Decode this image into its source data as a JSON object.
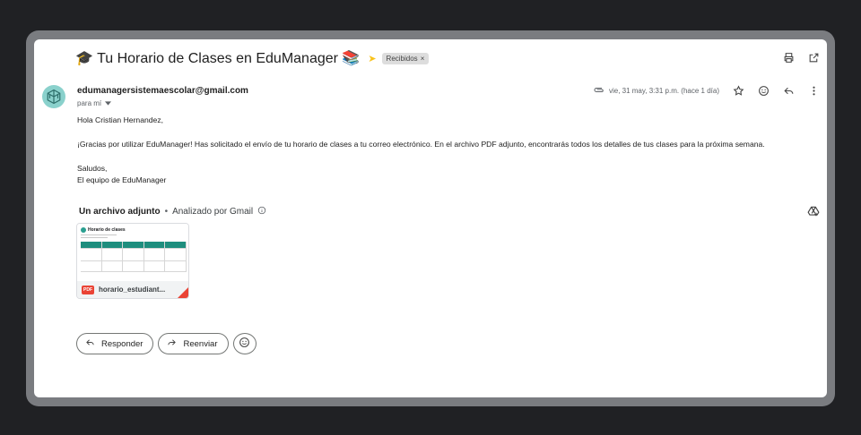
{
  "email": {
    "subject": "🎓 Tu Horario de Clases en EduManager 📚",
    "label": "Recibidos",
    "label_remove": "×",
    "sender": "edumanagersistemaescolar@gmail.com",
    "to": "para mí",
    "date": "vie, 31 may, 3:31 p.m. (hace 1 día)",
    "greeting": "Hola Cristian Hernandez,",
    "body": "¡Gracias por utilizar EduManager! Has solicitado el envío de tu horario de clases a tu correo electrónico. En el archivo PDF adjunto, encontrarás todos los detalles de tus clases para la próxima semana.",
    "closing": "Saludos,",
    "signature": "El equipo de EduManager"
  },
  "attachments": {
    "header": "Un archivo adjunto",
    "separator": "•",
    "scanned": "Analizado por Gmail",
    "file": {
      "thumb_title": "Horario de clases",
      "badge": "PDF",
      "name": "horario_estudiant..."
    }
  },
  "actions": {
    "reply": "Responder",
    "forward": "Reenviar"
  },
  "icons": [
    "print-icon",
    "open-new-window-icon",
    "attachment-clip-icon",
    "star-icon",
    "emoji-icon",
    "reply-icon",
    "more-vert-icon",
    "info-icon",
    "add-to-drive-icon",
    "chevron-down-icon"
  ],
  "colors": {
    "background": "#202124",
    "frame": "#7a7c80",
    "accent": "#f9c21a",
    "pdf": "#ea4335",
    "avatar": "#8ad1cc"
  }
}
